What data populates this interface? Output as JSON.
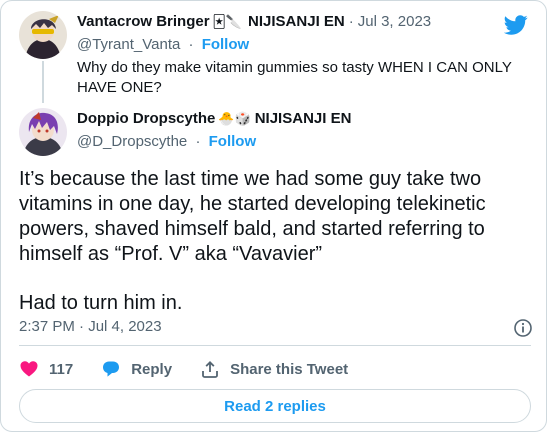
{
  "parent": {
    "name": "Vantacrow Bringer",
    "emojis": "🃏🔪",
    "org": "NIJISANJI EN",
    "date": "Jul 3, 2023",
    "handle": "@Tyrant_Vanta",
    "follow_label": "Follow",
    "text": "Why do they make vitamin gummies so tasty WHEN I CAN ONLY HAVE ONE?"
  },
  "tweet": {
    "name": "Doppio Dropscythe",
    "emojis": "🐣🎲",
    "org": "NIJISANJI EN",
    "handle": "@D_Dropscythe",
    "follow_label": "Follow",
    "paragraph1": "It’s because the last time we had some guy take two vitamins in one day, he started developing telekinetic powers, shaved himself bald, and started referring to himself as “Prof. V” aka “Vavavier”",
    "paragraph2": "Had to turn him in.",
    "timestamp": "2:37 PM · Jul 4, 2023"
  },
  "actions": {
    "like_count": "117",
    "reply_label": "Reply",
    "share_label": "Share this Tweet"
  },
  "read_replies_label": "Read 2 replies",
  "separator": "·",
  "icons": [
    "twitter-bird-icon",
    "info-icon",
    "heart-icon",
    "reply-icon",
    "share-icon"
  ],
  "colors": {
    "accent": "#1d9bf0",
    "like": "#f91880",
    "secondary_text": "#536471",
    "border": "#cfd9de"
  }
}
